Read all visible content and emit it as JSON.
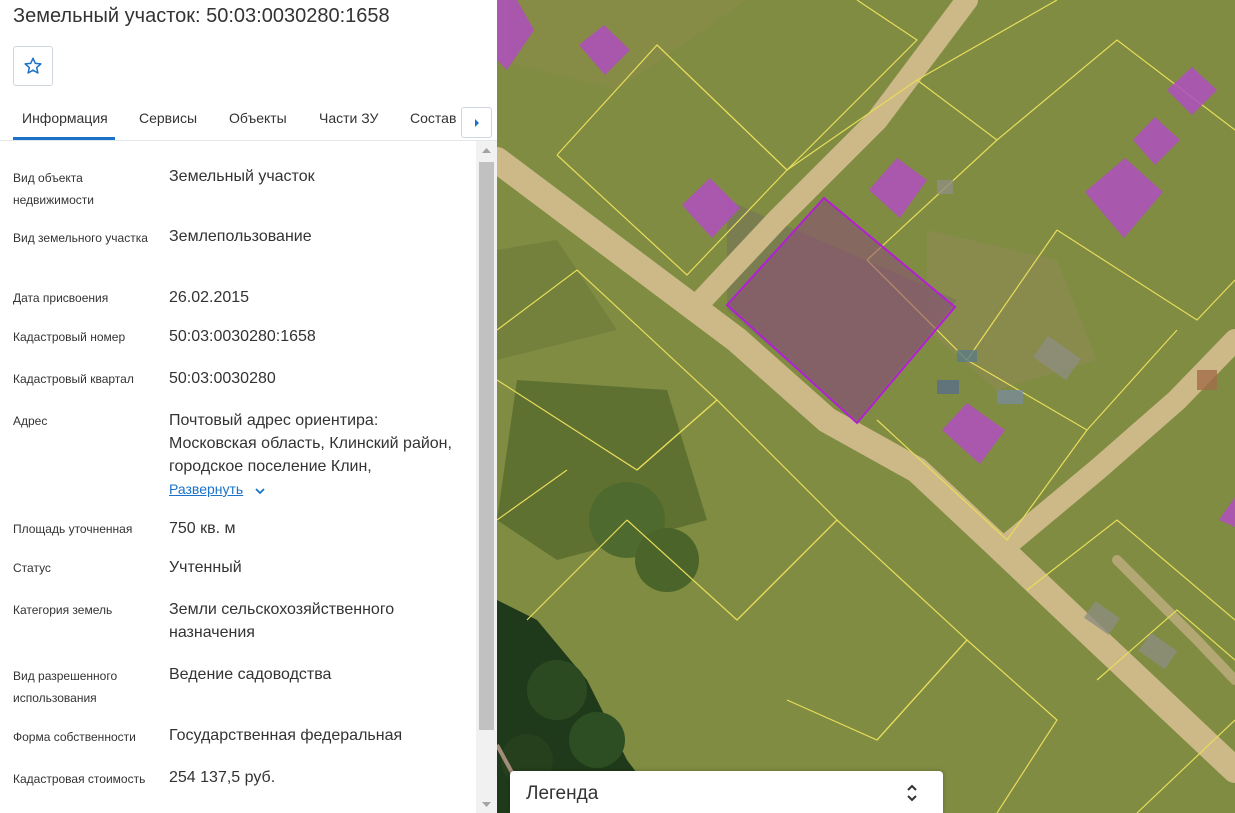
{
  "panel": {
    "title": "Земельный участок: 50:03:0030280:1658",
    "tabs": [
      {
        "label": "Информация"
      },
      {
        "label": "Сервисы"
      },
      {
        "label": "Объекты"
      },
      {
        "label": "Части ЗУ"
      },
      {
        "label": "Состав"
      }
    ],
    "rows": [
      {
        "label": "Вид объекта недвижимости",
        "value": "Земельный участок"
      },
      {
        "label": "Вид земельного участка",
        "value": "Землепользование"
      },
      {
        "label": "Дата присвоения",
        "value": "26.02.2015"
      },
      {
        "label": "Кадастровый номер",
        "value": "50:03:0030280:1658"
      },
      {
        "label": "Кадастровый квартал",
        "value": "50:03:0030280"
      },
      {
        "label": "Адрес",
        "value": "Почтовый адрес ориентира: Московская область, Клинский район, городское поселение Клин,"
      },
      {
        "label": "Площадь уточненная",
        "value": "750 кв. м"
      },
      {
        "label": "Статус",
        "value": "Учтенный"
      },
      {
        "label": "Категория земель",
        "value": "Земли сельскохозяйственного назначения"
      },
      {
        "label": "Вид разрешенного использования",
        "value": "Ведение садоводства"
      },
      {
        "label": "Форма собственности",
        "value": "Государственная федеральная"
      },
      {
        "label": "Кадастровая стоимость",
        "value": "254 137,5 руб."
      }
    ],
    "expand_link": "Развернуть"
  },
  "map": {
    "legend_label": "Легенда",
    "colors": {
      "parcel_border": "#e8dc5a",
      "selected_border": "#b21fd6",
      "building_fill": "#b04fc0",
      "road": "#cdb987"
    }
  },
  "icons": {
    "favorite": "star-icon",
    "tabs_next": "caret-right-icon",
    "expand": "chevron-down-icon",
    "legend_toggle": "chevron-up-down-icon"
  }
}
